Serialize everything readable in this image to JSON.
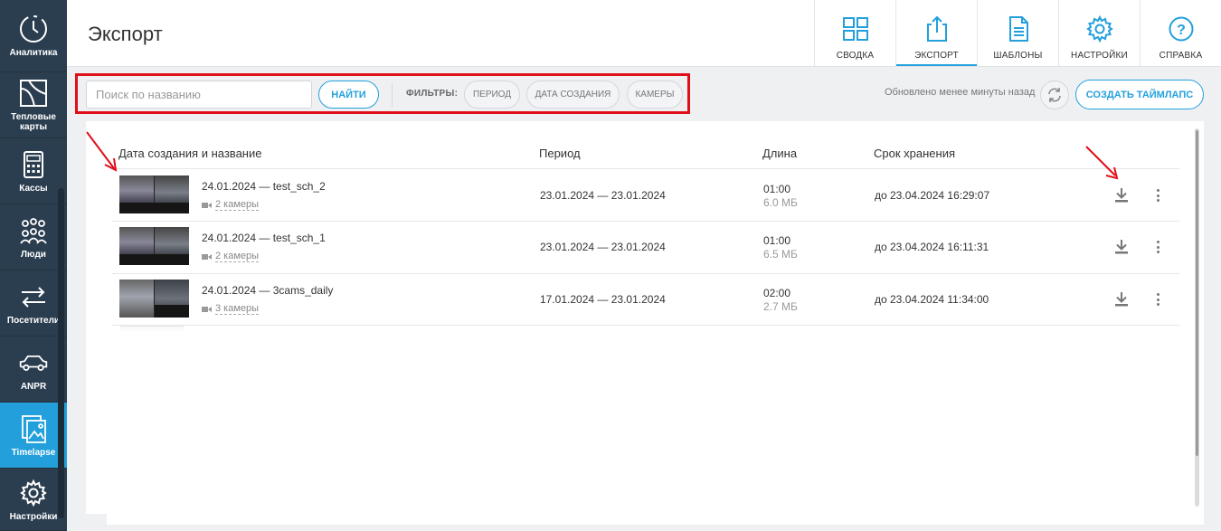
{
  "sidebar": {
    "items": [
      {
        "label": "Аналитика",
        "icon": "analytics-clock-icon"
      },
      {
        "label": "Тепловые\nкарты",
        "icon": "heatmap-icon"
      },
      {
        "label": "Кассы",
        "icon": "cash-register-icon"
      },
      {
        "label": "Люди",
        "icon": "people-icon"
      },
      {
        "label": "Посетители",
        "icon": "visitors-arrows-icon"
      },
      {
        "label": "ANPR",
        "icon": "car-icon"
      },
      {
        "label": "Timelapse",
        "icon": "timelapse-photos-icon"
      },
      {
        "label": "Настройки",
        "icon": "gear-icon"
      }
    ],
    "active": "Timelapse"
  },
  "header": {
    "title": "Экспорт",
    "nav": [
      {
        "label": "СВОДКА",
        "icon": "dashboard-grid-icon"
      },
      {
        "label": "ЭКСПОРТ",
        "icon": "export-upload-icon"
      },
      {
        "label": "ШАБЛОНЫ",
        "icon": "document-icon"
      },
      {
        "label": "НАСТРОЙКИ",
        "icon": "gear-icon"
      },
      {
        "label": "СПРАВКА",
        "icon": "help-icon"
      }
    ],
    "active_nav": "ЭКСПОРТ"
  },
  "toolbar": {
    "search_placeholder": "Поиск по названию",
    "search_value": "",
    "find_label": "НАЙТИ",
    "filters_label": "ФИЛЬТРЫ:",
    "filters": [
      "ПЕРИОД",
      "ДАТА СОЗДАНИЯ",
      "КАМЕРЫ"
    ],
    "updated_text": "Обновлено менее минуты назад",
    "create_label": "СОЗДАТЬ ТАЙМЛАПС"
  },
  "table": {
    "columns": [
      "Дата создания и название",
      "Период",
      "Длина",
      "Срок хранения"
    ],
    "rows": [
      {
        "name": "24.01.2024 — test_sch_2",
        "cameras": "2 камеры",
        "period": "23.01.2024 — 23.01.2024",
        "length": "01:00",
        "size": "6.0 МБ",
        "retention": "до 23.04.2024 16:29:07"
      },
      {
        "name": "24.01.2024 — test_sch_1",
        "cameras": "2 камеры",
        "period": "23.01.2024 — 23.01.2024",
        "length": "01:00",
        "size": "6.5 МБ",
        "retention": "до 23.04.2024 16:11:31"
      },
      {
        "name": "24.01.2024 — 3cams_daily",
        "cameras": "3 камеры",
        "period": "17.01.2024 — 23.01.2024",
        "length": "02:00",
        "size": "2.7 МБ",
        "retention": "до 23.04.2024 11:34:00"
      }
    ]
  },
  "colors": {
    "accent": "#23a0dc",
    "sidebar": "#2b3e50",
    "annotation": "#e0101a"
  }
}
